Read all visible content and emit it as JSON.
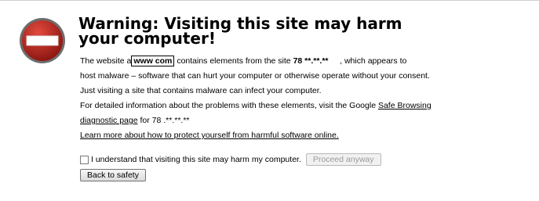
{
  "title": "Warning: Visiting this site may harm your computer!",
  "body": {
    "p1_prefix": "The website a",
    "p1_site": "www           com",
    "p1_mid": "contains elements from the site",
    "p1_ip": "78 **.**.**",
    "p1_suffix": ", which appears to",
    "p2": "host malware – software that can hurt your computer or otherwise operate without your consent.",
    "p3": "Just visiting a site that contains malware can infect your computer.",
    "p4_prefix": "For detailed information about the problems with these elements, visit the Google",
    "p4_link1": "Safe Browsing",
    "p5_link2": "diagnostic page",
    "p5_suffix": "for 78 .**.**.**",
    "p6_link": "Learn more about how to protect yourself from harmful software online."
  },
  "actions": {
    "checkbox_label": "I understand that visiting this site may harm my computer.",
    "proceed_label": "Proceed anyway",
    "back_label": "Back to safety"
  },
  "colors": {
    "icon_red": "#b71c1c",
    "icon_border": "#555555"
  }
}
